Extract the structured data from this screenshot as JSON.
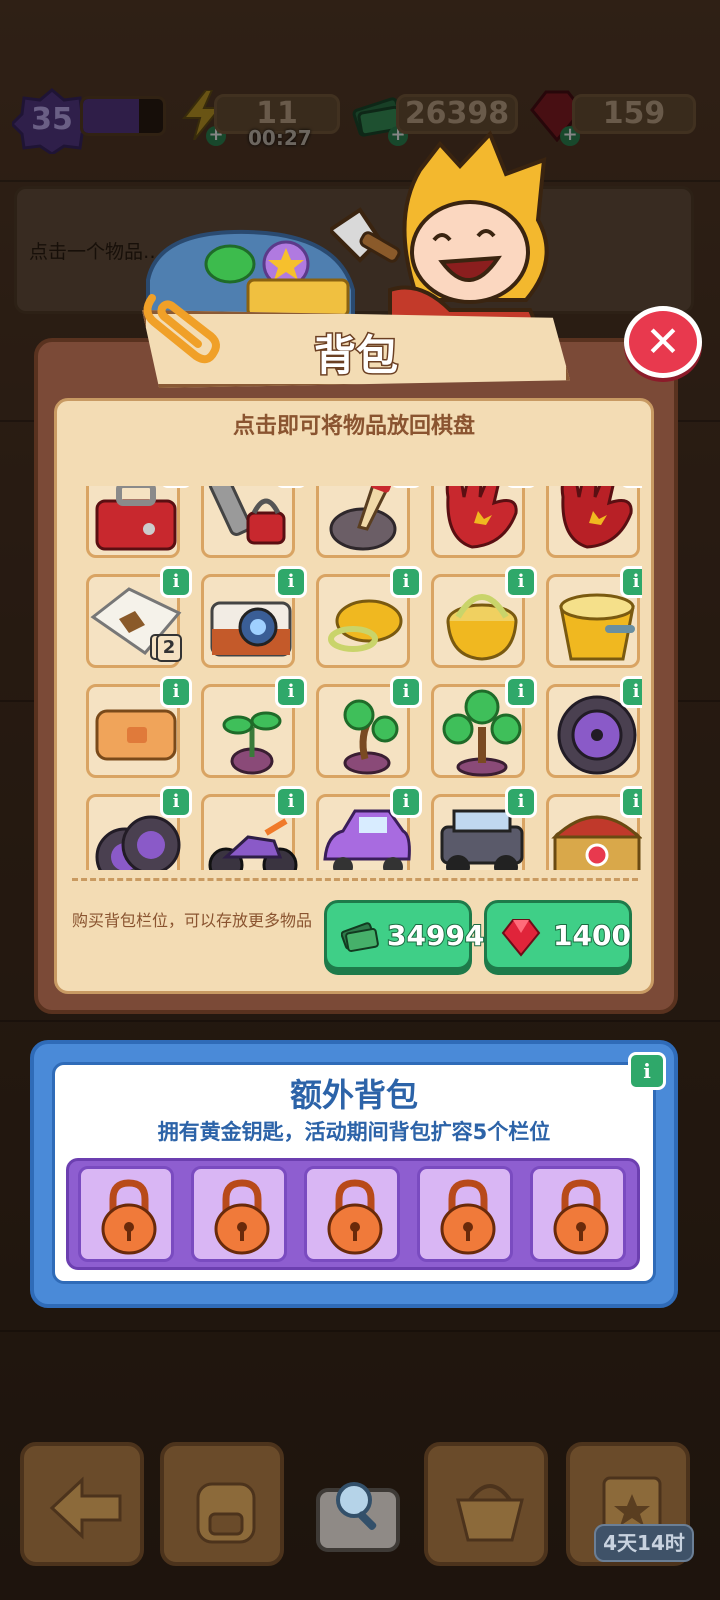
{
  "hud": {
    "level": "35",
    "level_progress": 0.7,
    "energy": "11",
    "energy_timer": "00:27",
    "cash": "26398",
    "gems": "159"
  },
  "hint": {
    "text": "点击一个物品……查看它的…"
  },
  "backpack": {
    "title": "背包",
    "instruction": "点击即可将物品放回棋盘",
    "items": [
      {
        "icon": "red-toolbox-icon",
        "info": false
      },
      {
        "icon": "padlock-chain-icon",
        "info": false
      },
      {
        "icon": "trowel-icon",
        "info": false
      },
      {
        "icon": "red-glove-icon",
        "info": false
      },
      {
        "icon": "red-gloves-icon",
        "info": false
      },
      {
        "icon": "treasure-map-icon",
        "info": true,
        "badge": "2"
      },
      {
        "icon": "camera-icon",
        "info": true
      },
      {
        "icon": "gold-ring-icon",
        "info": true
      },
      {
        "icon": "gold-basket-icon",
        "info": true
      },
      {
        "icon": "gold-bucket-icon",
        "info": true
      },
      {
        "icon": "leather-wallet-icon",
        "info": true
      },
      {
        "icon": "sprout-icon",
        "info": true
      },
      {
        "icon": "small-tree-icon",
        "info": true
      },
      {
        "icon": "bonsai-tree-icon",
        "info": true
      },
      {
        "icon": "wheel-icon",
        "info": true
      },
      {
        "icon": "tires-icon",
        "info": true
      },
      {
        "icon": "motorcycle-icon",
        "info": true
      },
      {
        "icon": "purple-car-icon",
        "info": true
      },
      {
        "icon": "jeep-icon",
        "info": true
      },
      {
        "icon": "treasure-chest-icon",
        "info": true
      }
    ],
    "buy_text": "购买背包栏位，可以存放更多物品",
    "buy_cash_price": "34994",
    "buy_gem_price": "1400",
    "info_glyph": "i"
  },
  "extra": {
    "title": "额外背包",
    "subtitle": "拥有黄金钥匙，活动期间背包扩容5个栏位",
    "locked_slots": 5
  },
  "bottom": {
    "event_timer": "4天14时"
  },
  "colors": {
    "panel": "#7b4a37",
    "parchment": "#f3dcb4",
    "green_button": "#3fcf87",
    "blue_panel": "#4a8ad8",
    "lock_purple": "#8e5ed0",
    "close_red": "#e8394e"
  }
}
